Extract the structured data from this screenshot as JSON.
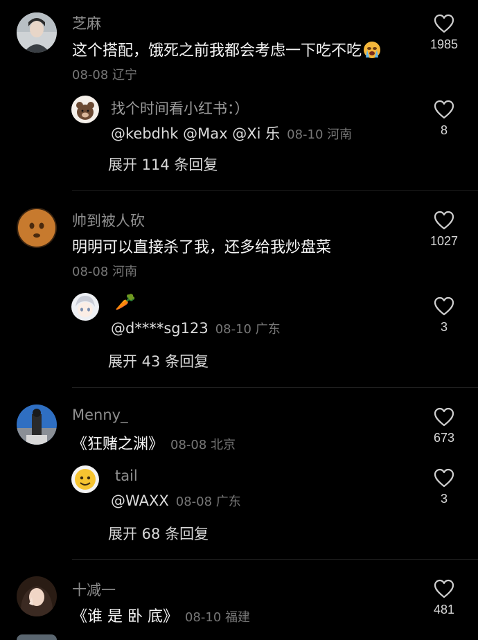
{
  "comments": [
    {
      "username": "芝麻",
      "text": "这个搭配，饿死之前我都会考虑一下吃不吃",
      "meta": "08-08 辽宁",
      "likes": "1985",
      "reply": {
        "username": "",
        "text": "找个时间看小红书：）",
        "mentions": "@kebdhk @Max @Xi 乐",
        "meta": "08-10 河南",
        "likes": "8"
      },
      "expand": "展开 114 条回复"
    },
    {
      "username": "帅到被人砍",
      "text": "明明可以直接杀了我，还多给我炒盘菜",
      "meta": "08-08 河南",
      "likes": "1027",
      "reply": {
        "username": "",
        "text": "🥕",
        "mentions": "@d****sg123",
        "meta": "08-10 广东",
        "likes": "3"
      },
      "expand": "展开 43 条回复"
    },
    {
      "username": "Menny_",
      "text": "《狂赌之渊》",
      "meta": "08-08 北京",
      "likes": "673",
      "reply": {
        "username": "tail",
        "text": "",
        "mentions": "@WAXX",
        "meta": "08-08 广东",
        "likes": "3"
      },
      "expand": "展开 68 条回复"
    },
    {
      "username": "十减一",
      "text": "《谁 是 卧 底》",
      "meta": "08-10 福建",
      "likes": "481"
    }
  ],
  "colors": {
    "background": "#000000",
    "username": "#8e8e8e",
    "text": "#f4f4f4",
    "meta": "#777777"
  },
  "icons": {
    "like": "heart-outline-icon",
    "crying-emoji": "crying-face-emoji"
  }
}
